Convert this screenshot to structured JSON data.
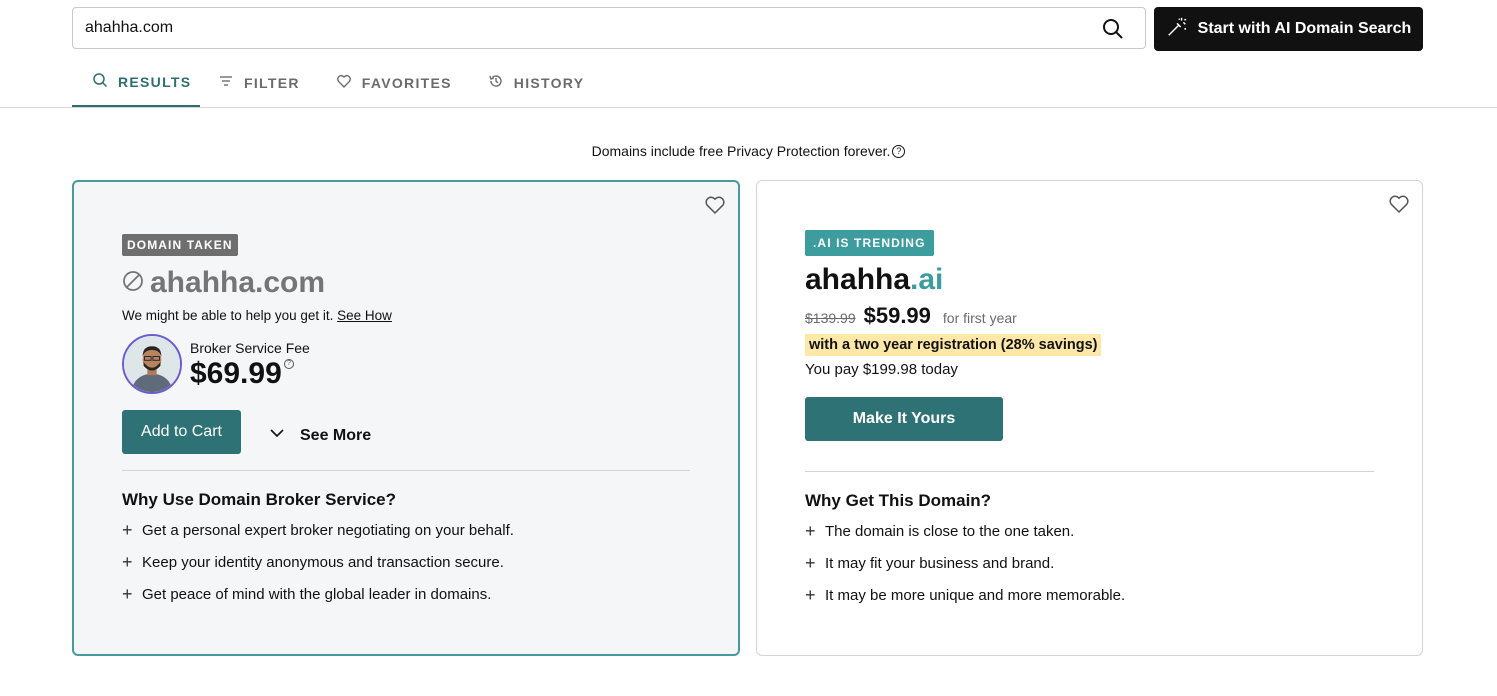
{
  "search": {
    "value": "ahahha.com",
    "ai_button_label": "Start with AI Domain Search"
  },
  "tabs": [
    {
      "label": "RESULTS",
      "icon": "search-icon",
      "active": true
    },
    {
      "label": "FILTER",
      "icon": "filter-icon",
      "active": false
    },
    {
      "label": "FAVORITES",
      "icon": "heart-icon",
      "active": false
    },
    {
      "label": "HISTORY",
      "icon": "history-icon",
      "active": false
    }
  ],
  "privacy_note": "Domains include free Privacy Protection forever.",
  "taken_card": {
    "badge": "DOMAIN TAKEN",
    "domain": "ahahha.com",
    "help_text": "We might be able to help you get it.",
    "help_link": "See How",
    "fee_label": "Broker Service Fee",
    "fee_value": "$69.99",
    "add_to_cart": "Add to Cart",
    "see_more": "See More",
    "why_title": "Why Use Domain Broker Service?",
    "why_items": [
      "Get a personal expert broker negotiating on your behalf.",
      "Keep your identity anonymous and transaction secure.",
      "Get peace of mind with the global leader in domains."
    ]
  },
  "suggest_card": {
    "badge": ".AI IS TRENDING",
    "domain_name": "ahahha",
    "domain_tld": ".ai",
    "price_old": "$139.99",
    "price_new": "$59.99",
    "price_term": "for first year",
    "savings": "with a two year registration (28% savings)",
    "you_pay": "You pay $199.98 today",
    "cta": "Make It Yours",
    "why_title": "Why Get This Domain?",
    "why_items": [
      "The domain is close to the one taken.",
      "It may fit your business and brand.",
      "It may be more unique and more memorable."
    ]
  },
  "colors": {
    "accent": "#2f7276",
    "teal_tld": "#3d9c9e",
    "highlight": "#fde8a8"
  }
}
